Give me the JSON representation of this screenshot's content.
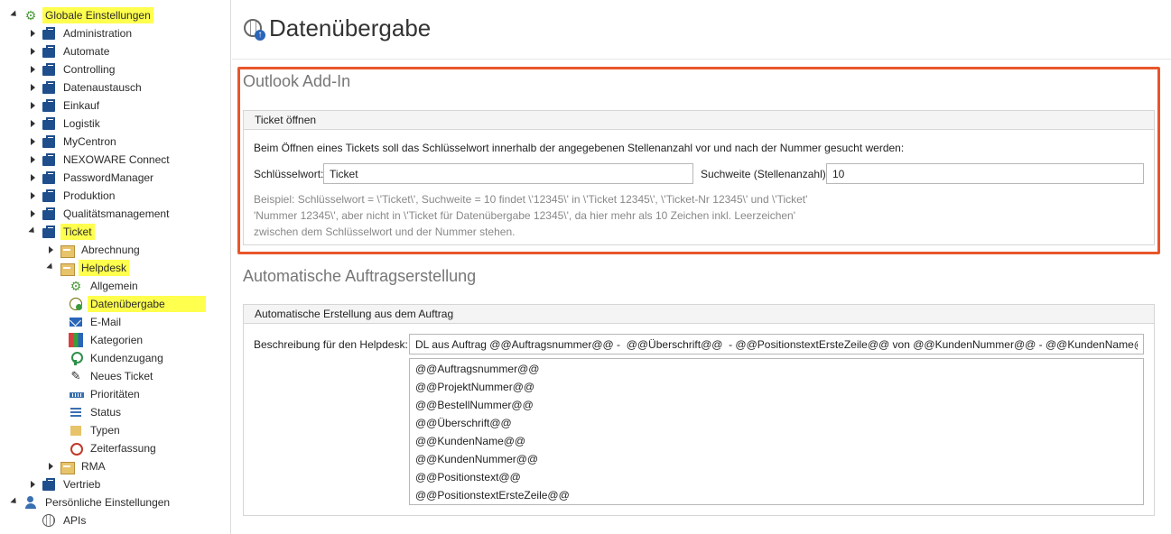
{
  "tree": {
    "root_global": "Globale Einstellungen",
    "items": [
      "Administration",
      "Automate",
      "Controlling",
      "Datenaustausch",
      "Einkauf",
      "Logistik",
      "MyCentron",
      "NEXOWARE Connect",
      "PasswordManager",
      "Produktion",
      "Qualitätsmanagement"
    ],
    "ticket": "Ticket",
    "ticket_children": {
      "abrechnung": "Abrechnung",
      "helpdesk": "Helpdesk",
      "helpdesk_children": [
        "Allgemein",
        "Datenübergabe",
        "E-Mail",
        "Kategorien",
        "Kundenzugang",
        "Neues Ticket",
        "Prioritäten",
        "Status",
        "Typen",
        "Zeiterfassung"
      ],
      "rma": "RMA"
    },
    "vertrieb": "Vertrieb",
    "personal": "Persönliche Einstellungen",
    "apis": "APIs"
  },
  "page": {
    "title": "Datenübergabe"
  },
  "outlook": {
    "title": "Outlook Add-In",
    "box_title": "Ticket öffnen",
    "description": "Beim Öffnen eines Tickets soll das Schlüsselwort innerhalb der angegebenen Stellenanzahl vor und nach der Nummer gesucht werden:",
    "keyword_label": "Schlüsselwort:",
    "keyword_value": "Ticket",
    "range_label": "Suchweite (Stellenanzahl):",
    "range_value": "10",
    "example_lines": [
      "Beispiel: Schlüsselwort = \\'Ticket\\', Suchweite = 10 findet \\'12345\\' in \\'Ticket 12345\\', \\'Ticket-Nr 12345\\' und \\'Ticket'",
      "'Nummer 12345\\', aber nicht in \\'Ticket für Datenübergabe 12345\\', da hier mehr als 10 Zeichen inkl. Leerzeichen'",
      "zwischen dem Schlüsselwort und der Nummer stehen."
    ]
  },
  "auto": {
    "title": "Automatische Auftragserstellung",
    "box_title": "Automatische Erstellung aus dem Auftrag",
    "desc_label": "Beschreibung für den Helpdesk:",
    "desc_value": "DL aus Auftrag @@Auftragsnummer@@ -  @@Überschrift@@  - @@PositionstextErsteZeile@@ von @@KundenNummer@@ - @@KundenName@@",
    "placeholders": [
      "@@Auftragsnummer@@",
      "@@ProjektNummer@@",
      "@@BestellNummer@@",
      "@@Überschrift@@",
      "@@KundenName@@",
      "@@KundenNummer@@",
      "@@Positionstext@@",
      "@@PositionstextErsteZeile@@"
    ]
  },
  "colors": {
    "highlight": "#ffff4d",
    "frame": "#e8562a",
    "briefcase": "#1f4e8c"
  }
}
